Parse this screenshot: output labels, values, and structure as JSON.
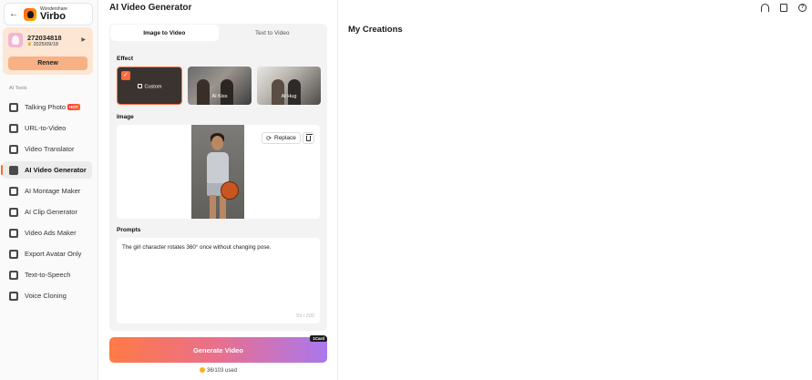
{
  "sidebar": {
    "brand_small": "Wondershare",
    "brand_big": "Virbo",
    "account": {
      "id": "272034818",
      "date": "2025/09/18",
      "renew": "Renew"
    },
    "tools_label": "AI Tools",
    "items": [
      {
        "label": "Talking Photo",
        "badge": "HOT"
      },
      {
        "label": "URL-to-Video"
      },
      {
        "label": "Video Translator"
      },
      {
        "label": "AI Video Generator",
        "active": true
      },
      {
        "label": "AI Montage Maker"
      },
      {
        "label": "AI Clip Generator"
      },
      {
        "label": "Video Ads Maker"
      },
      {
        "label": "Export Avatar Only"
      },
      {
        "label": "Text-to-Speech"
      },
      {
        "label": "Voice Cloning"
      }
    ]
  },
  "main": {
    "title": "AI Video Generator",
    "tabs": [
      {
        "label": "Image to Video",
        "active": true
      },
      {
        "label": "Text to Video"
      }
    ],
    "effect_label": "Effect",
    "effects": [
      {
        "label": "Custom",
        "selected": true
      },
      {
        "label": "AI Kiss"
      },
      {
        "label": "AI Hug"
      }
    ],
    "image_label": "Image",
    "replace": "Replace",
    "prompts_label": "Prompts",
    "prompt_text": "The girl character rotates 360° once without changing pose.",
    "prompt_count": "59 / 200",
    "generate": "Generate Video",
    "credit_badge": "1Card",
    "usage": "36/103 used"
  },
  "creations": {
    "title": "My Creations"
  },
  "colors": {
    "accent": "#ff6a2a",
    "gradient_start": "#ff7a45",
    "gradient_end": "#a978ee"
  }
}
